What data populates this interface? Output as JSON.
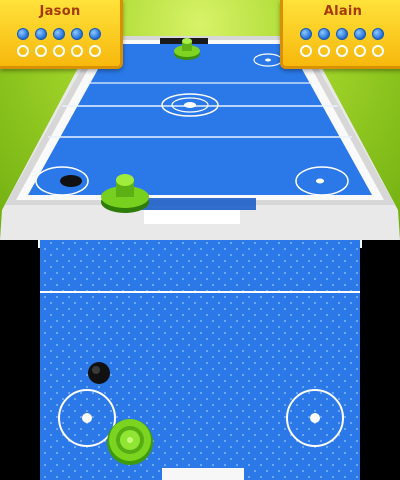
{
  "players": {
    "left": {
      "name": "Jason",
      "points": 5,
      "max_points": 10
    },
    "right": {
      "name": "Alain",
      "points": 5,
      "max_points": 10
    }
  },
  "colors": {
    "table_blue": "#2b79e8",
    "table_blue_dark": "#1b58c4",
    "rail_white": "#f2f2f2",
    "scorecard_yellow": "#ffd625",
    "name_text": "#a53a06",
    "mallet_green": "#6fcf1d",
    "puck_black": "#111111",
    "grass_green": "#a6d82c"
  },
  "icons": {
    "player_mallet": "green-mallet-icon",
    "opponent_mallet": "green-mallet-icon",
    "puck": "black-puck-icon"
  }
}
